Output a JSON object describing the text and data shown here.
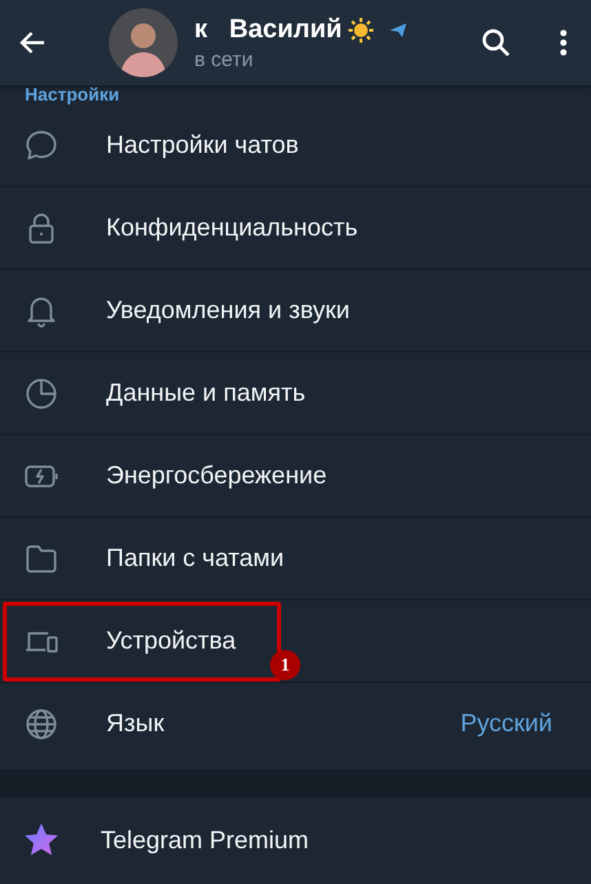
{
  "header": {
    "name": "к   Василий",
    "status": "в сети"
  },
  "section": {
    "title": "Настройки",
    "items": [
      {
        "kind": "chat",
        "label": "Настройки чатов",
        "highlighted": false
      },
      {
        "kind": "lock",
        "label": "Конфиденциальность",
        "highlighted": false
      },
      {
        "kind": "bell",
        "label": "Уведомления и звуки",
        "highlighted": false
      },
      {
        "kind": "pie",
        "label": "Данные и память",
        "highlighted": false
      },
      {
        "kind": "battery",
        "label": "Энергосбережение",
        "highlighted": false
      },
      {
        "kind": "folder",
        "label": "Папки с чатами",
        "highlighted": false
      },
      {
        "kind": "devices",
        "label": "Устройства",
        "highlighted": true,
        "badge": "1"
      },
      {
        "kind": "globe",
        "label": "Язык",
        "value": "Русский",
        "highlighted": false
      }
    ]
  },
  "premium": {
    "label": "Telegram Premium"
  }
}
